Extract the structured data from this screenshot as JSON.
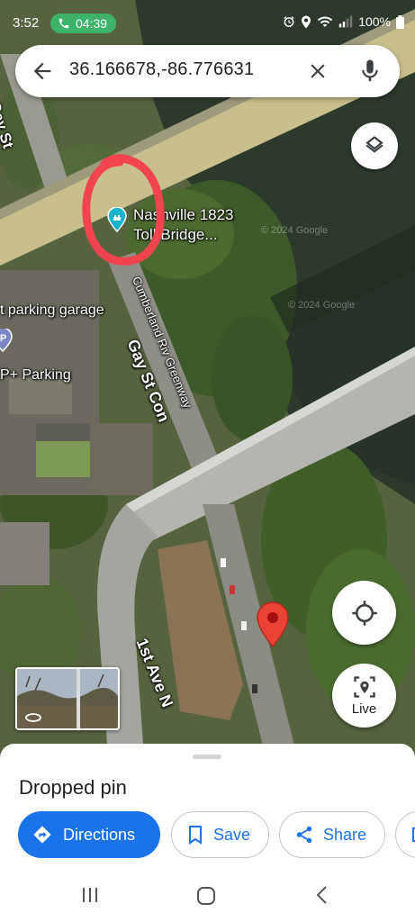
{
  "status_bar": {
    "time": "3:52",
    "call_timer": "04:39",
    "battery": "100%"
  },
  "search": {
    "query": "36.166678,-86.776631"
  },
  "map": {
    "labels": {
      "gay_st": "Gay St",
      "poi_line1": "Nashville 1823",
      "poi_line2": "Toll Bridge...",
      "parking_garage": "t parking garage",
      "p_parking": "P+ Parking",
      "greenway": "Cumberland Riv Greenway",
      "gay_st_con": "Gay St Con",
      "first_ave": "1st Ave N",
      "copyright_1": "© 2024 Google",
      "copyright_2": "© 2024 Google"
    },
    "pin_color": "#ea4335"
  },
  "controls": {
    "live_label": "Live"
  },
  "sheet": {
    "title": "Dropped pin",
    "actions": {
      "directions": "Directions",
      "save": "Save",
      "share": "Share"
    }
  },
  "colors": {
    "accent": "#1a73e8",
    "call_green": "#3db36a",
    "annotation_red": "#f2444f"
  }
}
